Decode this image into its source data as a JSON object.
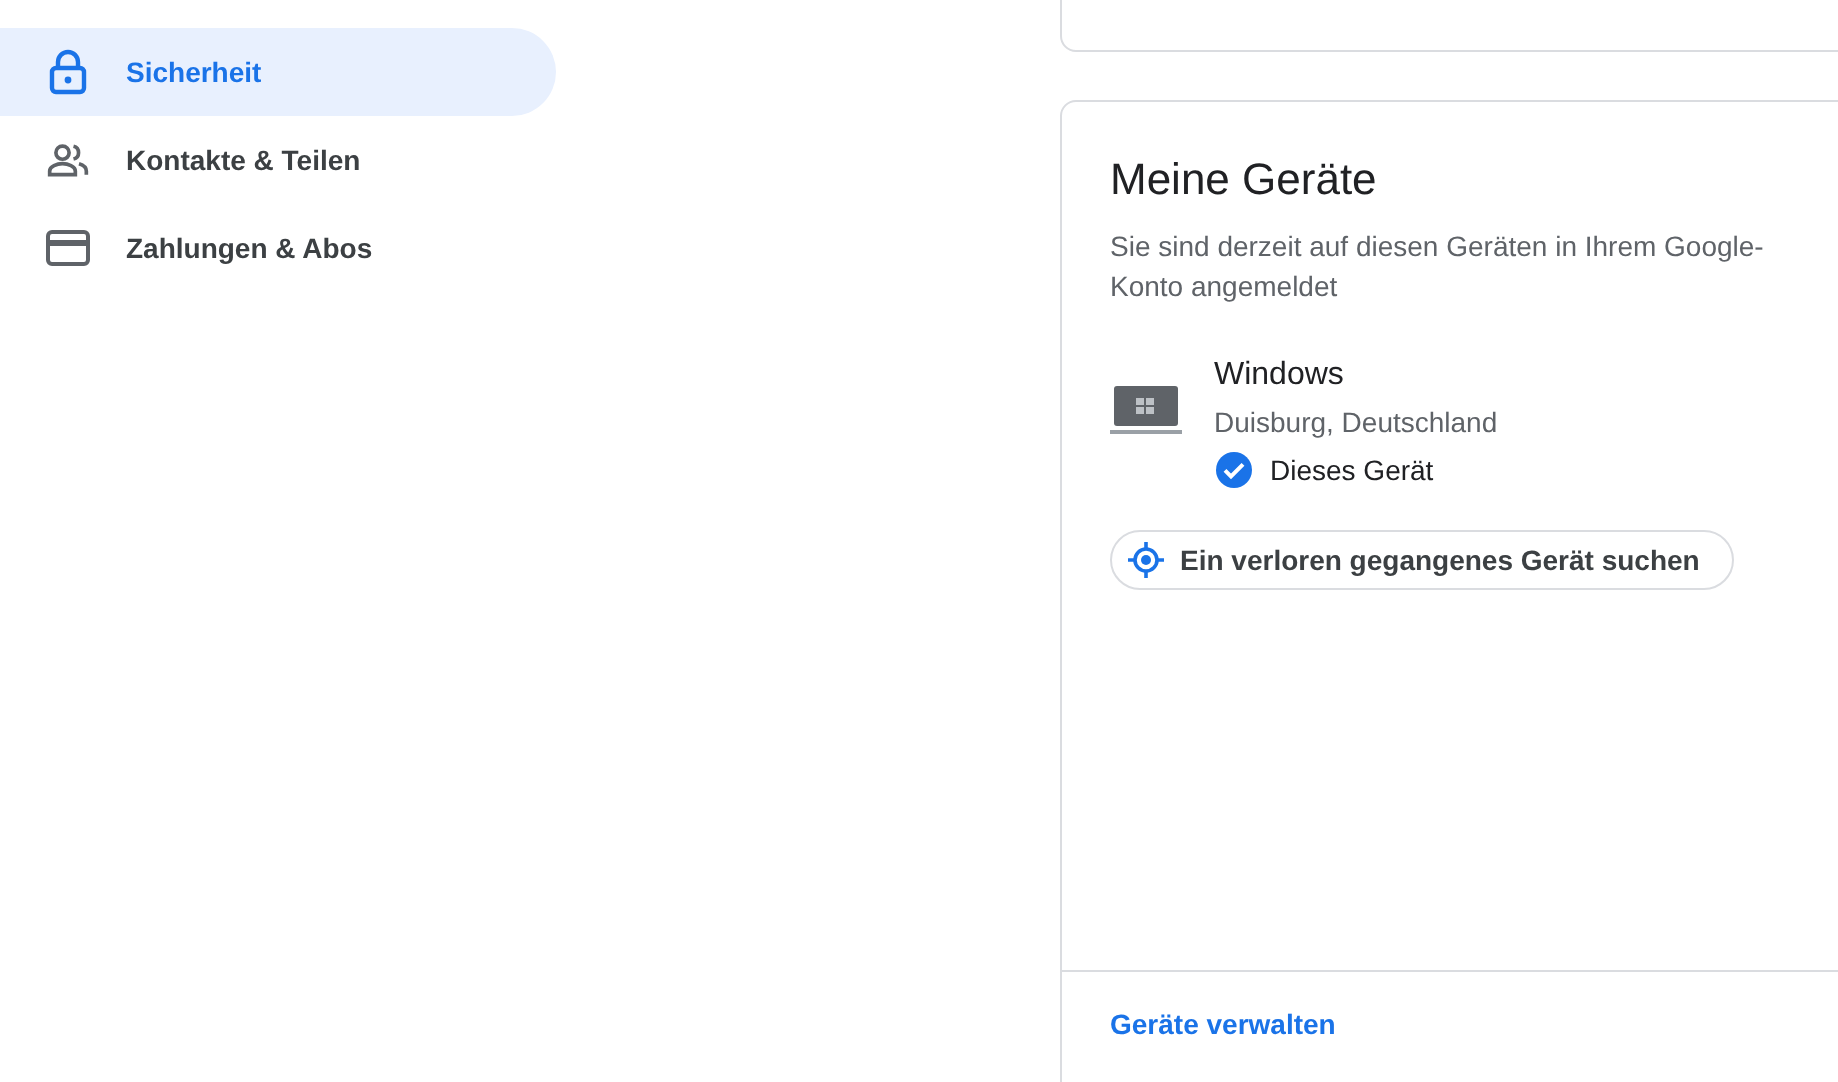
{
  "sidebar": {
    "items": [
      {
        "label": "Sicherheit",
        "selected": true
      },
      {
        "label": "Kontakte & Teilen",
        "selected": false
      },
      {
        "label": "Zahlungen & Abos",
        "selected": false
      }
    ]
  },
  "devices_card": {
    "title": "Meine Geräte",
    "description": "Sie sind derzeit auf diesen Geräten in Ihrem Google-Konto angemeldet",
    "devices": [
      {
        "name": "Windows",
        "location": "Duisburg, Deutschland",
        "current": true,
        "current_label": "Dieses Gerät"
      }
    ],
    "find_button": "Ein verloren gegangenes Gerät suchen",
    "manage_link": "Geräte verwalten"
  }
}
